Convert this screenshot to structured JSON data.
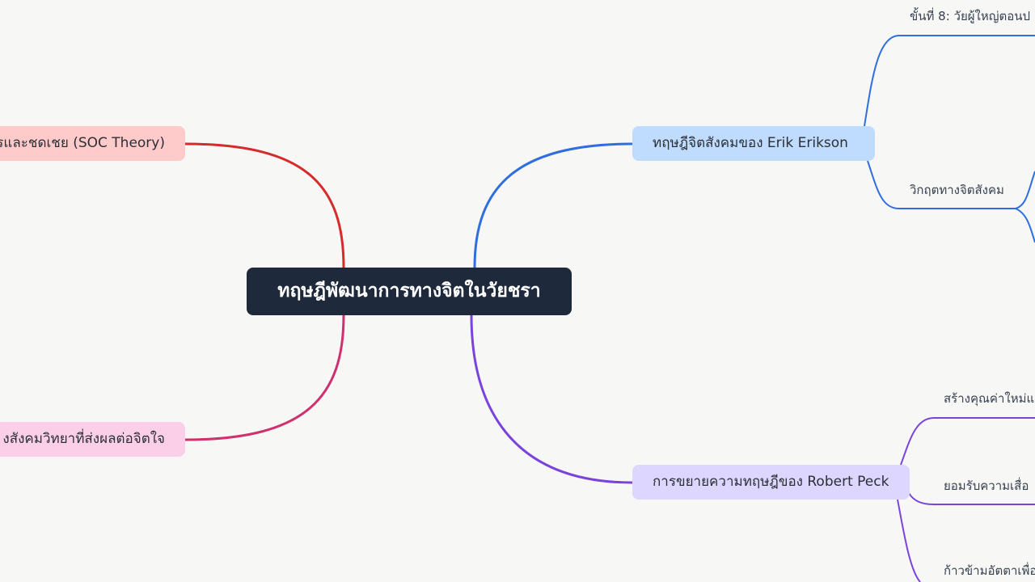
{
  "mindmap": {
    "center": "ทฤษฎีพัฒนาการทางจิตในวัยชรา",
    "left_branches": [
      {
        "label": "รและชดเชย (SOC Theory)",
        "color": "#d52b2b",
        "fill": "#fecaca"
      },
      {
        "label": "งสังคมวิทยาที่ส่งผลต่อจิตใจ",
        "color": "#d0306e",
        "fill": "#fbcfe8"
      }
    ],
    "right_branches": [
      {
        "label": "ทฤษฎีจิตสังคมของ Erik Erikson",
        "color": "#2f6ee0",
        "fill": "#bfdbfe",
        "children": [
          "ขั้นที่ 8: วัยผู้ใหญ่ตอนป",
          "วิกฤตทางจิตสังคม"
        ]
      },
      {
        "label": "การขยายความทฤษฎีของ Robert Peck",
        "color": "#7a44dc",
        "fill": "#ddd6fe",
        "children": [
          "สร้างคุณค่าใหม่แ",
          "ยอมรับความเสื่อ",
          "ก้าวข้ามอัตตาเพื่อ"
        ]
      }
    ]
  }
}
